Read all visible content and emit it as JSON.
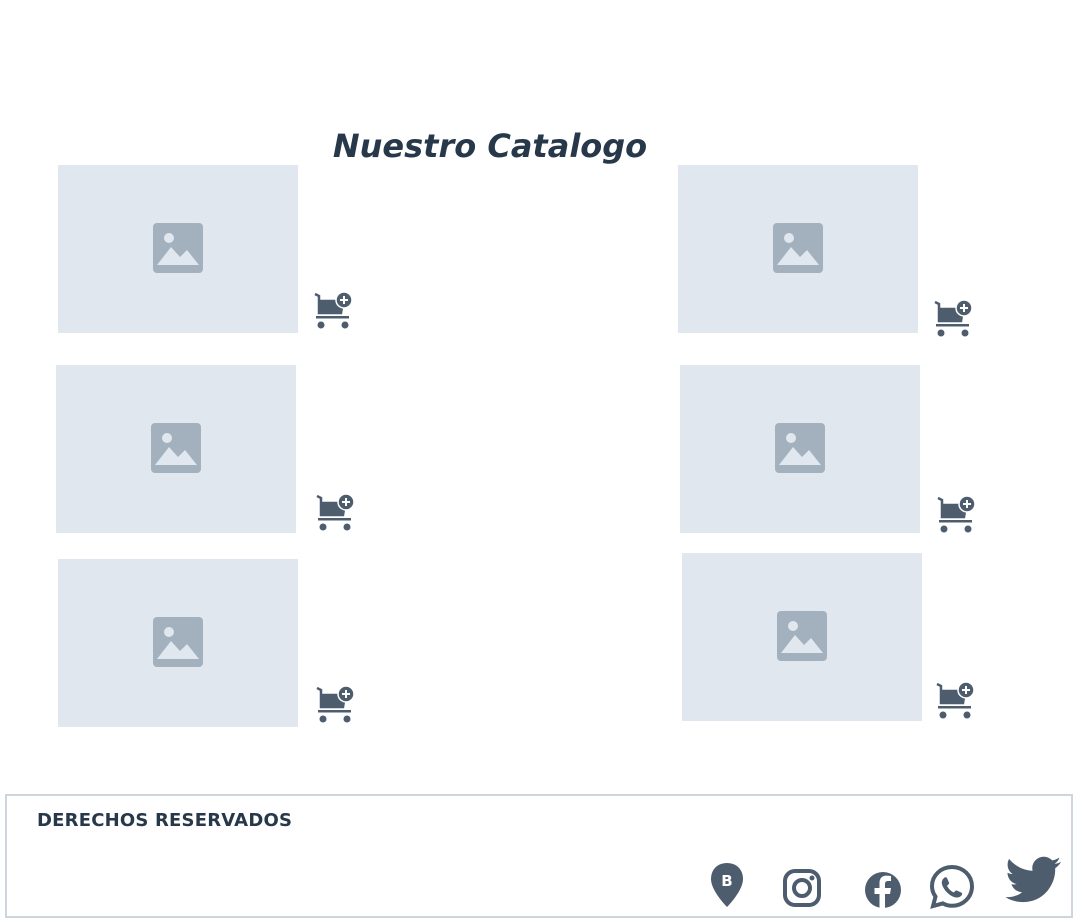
{
  "catalog": {
    "title": "Nuestro Catalogo",
    "products": [
      {
        "image_icon": "image-placeholder-icon",
        "cart_icon": "add-to-cart-icon"
      },
      {
        "image_icon": "image-placeholder-icon",
        "cart_icon": "add-to-cart-icon"
      },
      {
        "image_icon": "image-placeholder-icon",
        "cart_icon": "add-to-cart-icon"
      },
      {
        "image_icon": "image-placeholder-icon",
        "cart_icon": "add-to-cart-icon"
      },
      {
        "image_icon": "image-placeholder-icon",
        "cart_icon": "add-to-cart-icon"
      },
      {
        "image_icon": "image-placeholder-icon",
        "cart_icon": "add-to-cart-icon"
      }
    ]
  },
  "footer": {
    "rights_text": "DERECHOS RESERVADOS",
    "location_badge": "B",
    "social_icons": [
      "location-pin-icon",
      "instagram-icon",
      "facebook-icon",
      "whatsapp-icon",
      "twitter-icon"
    ]
  },
  "colors": {
    "title": "#27384a",
    "placeholder_bg": "#e1e7ef",
    "placeholder_icon": "#a3b1bf",
    "icons": "#4d5d6e",
    "footer_border": "#cdd6df"
  }
}
